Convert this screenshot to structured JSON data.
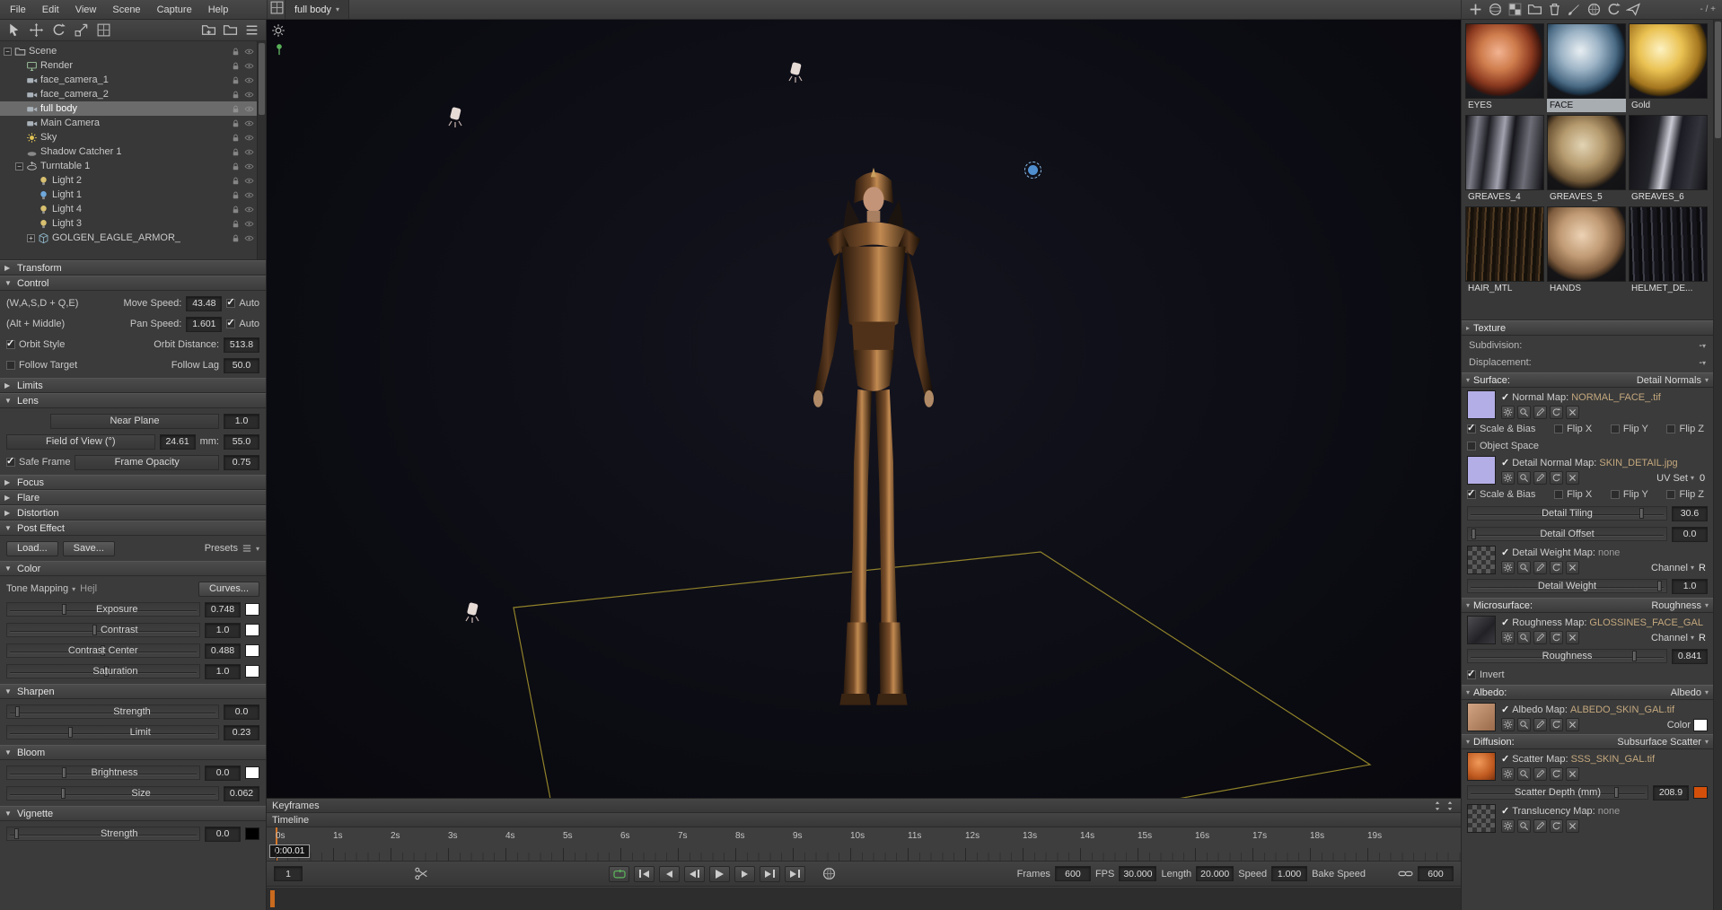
{
  "menubar": {
    "items": [
      "File",
      "Edit",
      "View",
      "Scene",
      "Capture",
      "Help"
    ]
  },
  "window_controls": "- / +",
  "viewport": {
    "tab": "full body"
  },
  "toolbars": {
    "left": [
      {
        "icon": "cursor",
        "name": "select-tool"
      },
      {
        "icon": "move",
        "name": "translate-tool"
      },
      {
        "icon": "reload",
        "name": "rotate-tool"
      },
      {
        "icon": "scale",
        "name": "scale-tool"
      },
      {
        "icon": "grid",
        "name": "snap-tool"
      }
    ],
    "left_right": [
      {
        "icon": "folder-new",
        "name": "add-folder"
      },
      {
        "icon": "folder",
        "name": "group-objects"
      },
      {
        "icon": "list",
        "name": "outliner-filter"
      }
    ],
    "right": [
      {
        "icon": "plus",
        "name": "new-material"
      },
      {
        "icon": "sphere",
        "name": "material-preview"
      },
      {
        "icon": "checker",
        "name": "default-material"
      },
      {
        "icon": "folder",
        "name": "material-folder"
      },
      {
        "icon": "trash",
        "name": "delete-material"
      },
      {
        "icon": "brush",
        "name": "paint-material"
      },
      {
        "icon": "globe",
        "name": "environment-library"
      },
      {
        "icon": "reload",
        "name": "refresh-library"
      },
      {
        "icon": "send",
        "name": "apply-material"
      }
    ]
  },
  "scene_tree": {
    "items": [
      {
        "label": "Scene",
        "depth": 0,
        "icon": "scene",
        "caret": "open"
      },
      {
        "label": "Render",
        "depth": 1,
        "icon": "render"
      },
      {
        "label": "face_camera_1",
        "depth": 1,
        "icon": "camera"
      },
      {
        "label": "face_camera_2",
        "depth": 1,
        "icon": "camera"
      },
      {
        "label": "full body",
        "depth": 1,
        "icon": "camera",
        "selected": true
      },
      {
        "label": "Main Camera",
        "depth": 1,
        "icon": "camera"
      },
      {
        "label": "Sky",
        "depth": 1,
        "icon": "sky"
      },
      {
        "label": "Shadow Catcher 1",
        "depth": 1,
        "icon": "shadow"
      },
      {
        "label": "Turntable 1",
        "depth": 1,
        "icon": "turntable",
        "caret": "open"
      },
      {
        "label": "Light 2",
        "depth": 2,
        "icon": "light"
      },
      {
        "label": "Light 1",
        "depth": 2,
        "icon": "light-blue"
      },
      {
        "label": "Light 4",
        "depth": 2,
        "icon": "light"
      },
      {
        "label": "Light 3",
        "depth": 2,
        "icon": "light"
      },
      {
        "label": "GOLGEN_EAGLE_ARMOR_",
        "depth": 2,
        "icon": "model",
        "caret": "closed"
      }
    ]
  },
  "camera_props": {
    "sections": [
      {
        "title": "Transform",
        "collapsed": true,
        "rows": []
      },
      {
        "title": "Control",
        "collapsed": false,
        "rows": [
          {
            "type": "controls2",
            "left": "(W,A,S,D + Q,E)",
            "label": "Move Speed:",
            "value": "43.48",
            "check": {
              "v": "Auto",
              "on": true
            }
          },
          {
            "type": "controls2",
            "left": "(Alt + Middle)",
            "label": "Pan Speed:",
            "value": "1.601",
            "check": {
              "v": "Auto",
              "on": true
            }
          },
          {
            "type": "controls2",
            "leftcheck": {
              "v": "Orbit Style",
              "on": true
            },
            "label": "Orbit Distance:",
            "value": "513.8"
          },
          {
            "type": "controls2",
            "leftcheck": {
              "v": "Follow Target",
              "on": false
            },
            "label": "Follow Lag",
            "value": "50.0"
          }
        ]
      },
      {
        "title": "Limits",
        "collapsed": true,
        "rows": []
      },
      {
        "title": "Lens",
        "collapsed": false,
        "rows": [
          {
            "type": "boxrow",
            "ind": true,
            "box": "Near Plane",
            "value": "1.0"
          },
          {
            "type": "boxrow",
            "box": "Field of View (°)",
            "value": "24.61",
            "label2": "mm:",
            "value2": "55.0"
          },
          {
            "type": "boxrow",
            "check": {
              "v": "Safe Frame",
              "on": true
            },
            "box": "Frame Opacity",
            "value": "0.75"
          }
        ]
      },
      {
        "title": "Focus",
        "collapsed": true,
        "rows": []
      },
      {
        "title": "Flare",
        "collapsed": true,
        "rows": []
      },
      {
        "title": "Distortion",
        "collapsed": true,
        "rows": []
      },
      {
        "title": "Post Effect",
        "collapsed": false,
        "rows": [
          {
            "type": "buttons",
            "items": [
              "Load...",
              "Save..."
            ],
            "right": "Presets"
          }
        ]
      },
      {
        "title": "Color",
        "collapsed": false,
        "rows": [
          {
            "type": "dropdown",
            "label": "Tone Mapping",
            "sel": "Hejl",
            "right_btn": "Curves..."
          },
          {
            "type": "slider",
            "label": "Exposure",
            "value": "0.748",
            "t": 0.3,
            "swatch": "#ffffff"
          },
          {
            "type": "slider",
            "label": "Contrast",
            "value": "1.0",
            "t": 0.46,
            "swatch": "#ffffff"
          },
          {
            "type": "slider",
            "label": "Contrast Center",
            "value": "0.488",
            "t": 0.5,
            "swatch": "#ffffff"
          },
          {
            "type": "slider",
            "label": "Saturation",
            "value": "1.0",
            "t": 0.52,
            "swatch": "#ffffff"
          }
        ]
      },
      {
        "title": "Sharpen",
        "collapsed": false,
        "rows": [
          {
            "type": "slider",
            "label": "Strength",
            "value": "0.0",
            "t": 0.05
          },
          {
            "type": "slider",
            "label": "Limit",
            "value": "0.23",
            "t": 0.3
          }
        ]
      },
      {
        "title": "Bloom",
        "collapsed": false,
        "rows": [
          {
            "type": "slider",
            "label": "Brightness",
            "value": "0.0",
            "t": 0.3,
            "swatch": "#ffffff"
          },
          {
            "type": "slider",
            "label": "Size",
            "value": "0.062",
            "t": 0.27
          }
        ]
      },
      {
        "title": "Vignette",
        "collapsed": false,
        "rows": [
          {
            "type": "slider",
            "label": "Strength",
            "value": "0.0",
            "t": 0.05,
            "swatch": "#000000"
          }
        ]
      }
    ]
  },
  "materials": {
    "items": [
      {
        "name": "EYES",
        "style": "eyes"
      },
      {
        "name": "FACE",
        "style": "face",
        "selected": true
      },
      {
        "name": "Gold",
        "style": "gold"
      },
      {
        "name": "GREAVES_4",
        "style": "greaves4"
      },
      {
        "name": "GREAVES_5",
        "style": "greaves5"
      },
      {
        "name": "GREAVES_6",
        "style": "greaves6"
      },
      {
        "name": "HAIR_MTL",
        "style": "hair"
      },
      {
        "name": "HANDS",
        "style": "hands"
      },
      {
        "name": "HELMET_DE...",
        "style": "helmet"
      }
    ]
  },
  "material_props": {
    "map_icons": [
      "gear",
      "search",
      "pencil",
      "reload",
      "close"
    ],
    "sections": [
      {
        "title": "Texture",
        "rows": [
          {
            "type": "subrow",
            "label": "Subdivision:",
            "value": "-"
          },
          {
            "type": "subrow",
            "label": "Displacement:",
            "value": "-"
          }
        ]
      },
      {
        "title": "Surface:",
        "right": "Detail Normals",
        "rows": [
          {
            "type": "mapblock",
            "thumb": "normal",
            "label": "Normal Map:",
            "value": "NORMAL_FACE_.tif"
          },
          {
            "type": "checks",
            "items": [
              {
                "v": "Scale & Bias",
                "on": true
              },
              {
                "v": "Flip X",
                "on": false
              },
              {
                "v": "Flip Y",
                "on": false
              },
              {
                "v": "Flip Z",
                "on": false
              }
            ]
          },
          {
            "type": "checks",
            "items": [
              {
                "v": "Object Space",
                "on": false
              }
            ]
          },
          {
            "type": "mapblock",
            "thumb": "normal",
            "label": "Detail Normal Map:",
            "value": "SKIN_DETAIL.jpg",
            "right": {
              "kind": "dropdown",
              "label": "UV Set",
              "value": "0"
            }
          },
          {
            "type": "checks",
            "items": [
              {
                "v": "Scale & Bias",
                "on": true
              },
              {
                "v": "Flip X",
                "on": false
              },
              {
                "v": "Flip Y",
                "on": false
              },
              {
                "v": "Flip Z",
                "on": false
              }
            ]
          },
          {
            "type": "slider",
            "label": "Detail Tiling",
            "value": "30.6",
            "t": 0.88
          },
          {
            "type": "slider",
            "label": "Detail Offset",
            "value": "0.0",
            "t": 0.03
          },
          {
            "type": "mapblock",
            "thumb": "checker",
            "label": "Detail Weight Map:",
            "value": "none",
            "right": {
              "kind": "dropdown",
              "label": "Channel",
              "value": "R"
            }
          },
          {
            "type": "slider",
            "label": "Detail Weight",
            "value": "1.0",
            "t": 0.97
          }
        ]
      },
      {
        "title": "Microsurface:",
        "right": "Roughness",
        "rows": [
          {
            "type": "mapblock",
            "thumb": "rough",
            "label": "Roughness Map:",
            "value": "GLOSSINES_FACE_GAL",
            "right": {
              "kind": "dropdown",
              "label": "Channel",
              "value": "R"
            }
          },
          {
            "type": "slider",
            "label": "Roughness",
            "value": "0.841",
            "t": 0.84
          },
          {
            "type": "checks",
            "items": [
              {
                "v": "Invert",
                "on": true
              }
            ]
          }
        ]
      },
      {
        "title": "Albedo:",
        "right": "Albedo",
        "rows": [
          {
            "type": "mapblock",
            "thumb": "albedo",
            "label": "Albedo Map:",
            "value": "ALBEDO_SKIN_GAL.tif",
            "right": {
              "kind": "swatch",
              "label": "Color",
              "swatch": "#ffffff"
            }
          }
        ]
      },
      {
        "title": "Diffusion:",
        "right": "Subsurface Scatter",
        "rows": [
          {
            "type": "mapblock",
            "thumb": "scatter",
            "label": "Scatter Map:",
            "value": "SSS_SKIN_GAL.tif"
          },
          {
            "type": "slider",
            "label": "Scatter Depth (mm)",
            "value": "208.9",
            "t": 0.83,
            "swatch": "#d4500a"
          },
          {
            "type": "mapblock",
            "thumb": "checker",
            "label": "Translucency Map:",
            "value": "none"
          }
        ]
      }
    ]
  },
  "timeline": {
    "keyframes_label": "Keyframes",
    "timeline_label": "Timeline",
    "current_time": "0:00.01",
    "frame_number": "1",
    "ticks": [
      "0s",
      "1s",
      "2s",
      "3s",
      "4s",
      "5s",
      "6s",
      "7s",
      "8s",
      "9s",
      "10s",
      "11s",
      "12s",
      "13s",
      "14s",
      "15s",
      "16s",
      "17s",
      "18s",
      "19s"
    ],
    "buttons": [
      "loop",
      "jump-start",
      "prev-key",
      "step-back",
      "play",
      "step-forward",
      "next-key",
      "jump-end"
    ],
    "fields": [
      {
        "label": "Frames",
        "value": "600"
      },
      {
        "label": "FPS",
        "value": "30.000"
      },
      {
        "label": "Length",
        "value": "20.000"
      },
      {
        "label": "Speed",
        "value": "1.000"
      }
    ],
    "bake_label": "Bake Speed",
    "link_value": "600"
  }
}
